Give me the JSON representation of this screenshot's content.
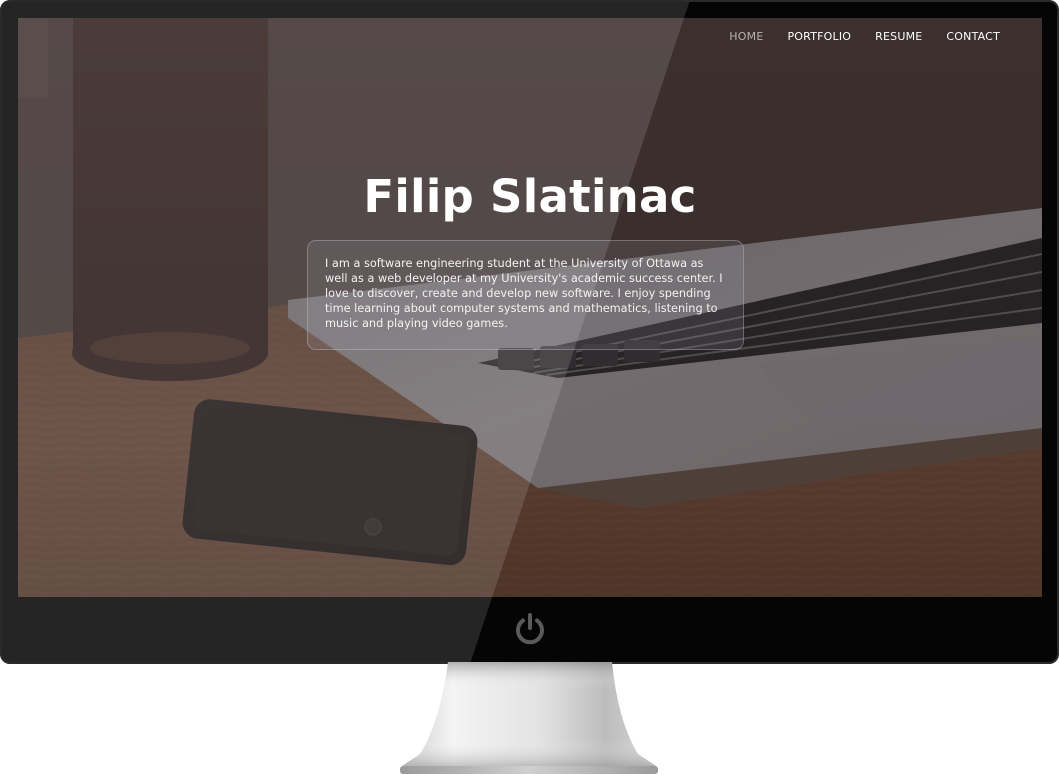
{
  "nav": {
    "items": [
      {
        "label": "HOME",
        "active": true
      },
      {
        "label": "PORTFOLIO",
        "active": false
      },
      {
        "label": "RESUME",
        "active": false
      },
      {
        "label": "CONTACT",
        "active": false
      }
    ]
  },
  "hero": {
    "title": "Filip Slatinac",
    "bio": "I am a software engineering student at the University of Ottawa as well as a web developer at my University's academic success center. I love to discover, create and develop new software. I enjoy spending time learning about computer systems and mathematics, listening to music and playing video games."
  },
  "icons": {
    "power": "power-icon"
  },
  "colors": {
    "monitor_bezel": "#050505",
    "nav_active": "#b9b2ae",
    "nav_text": "#ffffff",
    "title_text": "#ffffff"
  }
}
